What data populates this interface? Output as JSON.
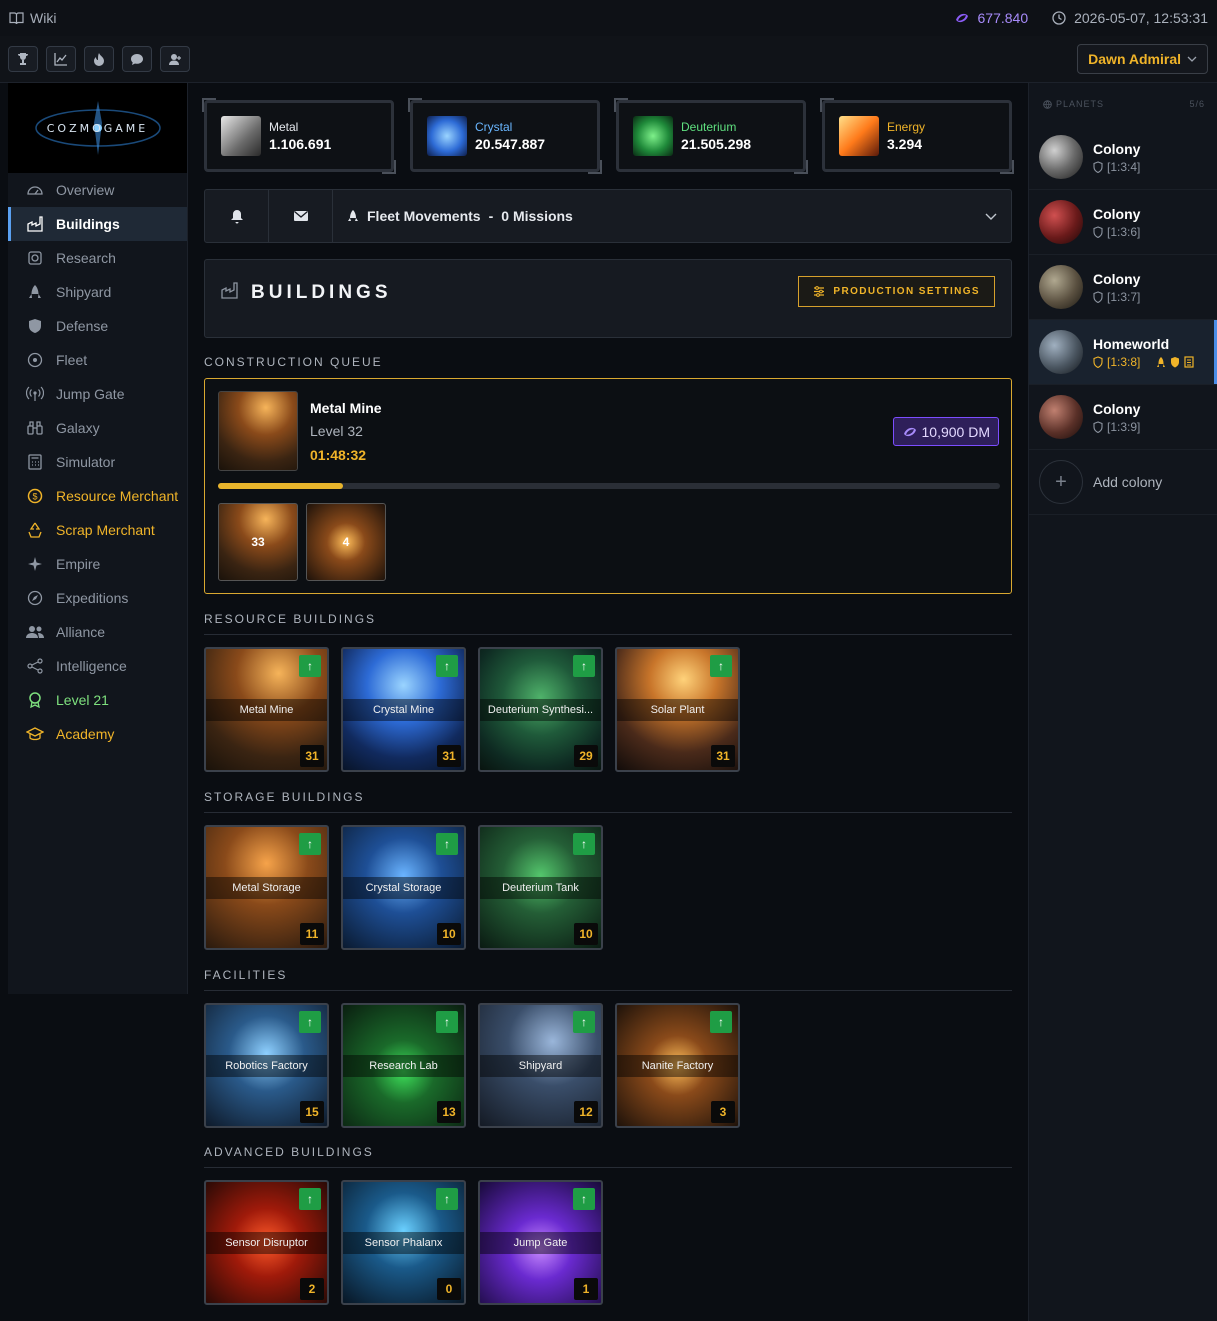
{
  "topbar": {
    "wiki": "Wiki",
    "dm": "677.840",
    "datetime": "2026-05-07, 12:53:31"
  },
  "toolbar": {
    "user": "Dawn Admiral"
  },
  "logo": "COZMOGAME",
  "nav": [
    {
      "label": "Overview",
      "icon": "dashboard-icon"
    },
    {
      "label": "Buildings",
      "icon": "factory-icon"
    },
    {
      "label": "Research",
      "icon": "research-icon"
    },
    {
      "label": "Shipyard",
      "icon": "rocket-icon"
    },
    {
      "label": "Defense",
      "icon": "shield-icon"
    },
    {
      "label": "Fleet",
      "icon": "fleet-icon"
    },
    {
      "label": "Jump Gate",
      "icon": "antenna-icon"
    },
    {
      "label": "Galaxy",
      "icon": "binoculars-icon"
    },
    {
      "label": "Simulator",
      "icon": "calculator-icon"
    },
    {
      "label": "Resource Merchant",
      "icon": "coin-icon"
    },
    {
      "label": "Scrap Merchant",
      "icon": "recycle-icon"
    },
    {
      "label": "Empire",
      "icon": "sparkle-icon"
    },
    {
      "label": "Expeditions",
      "icon": "compass-icon"
    },
    {
      "label": "Alliance",
      "icon": "users-icon"
    },
    {
      "label": "Intelligence",
      "icon": "share-icon"
    },
    {
      "label": "Level 21",
      "icon": "award-icon"
    },
    {
      "label": "Academy",
      "icon": "graduation-icon"
    }
  ],
  "resources": [
    {
      "name": "Metal",
      "value": "1.106.691",
      "color": "#e6e9ee"
    },
    {
      "name": "Crystal",
      "value": "20.547.887",
      "color": "#6ab7ff"
    },
    {
      "name": "Deuterium",
      "value": "21.505.298",
      "color": "#5fe07f"
    },
    {
      "name": "Energy",
      "value": "3.294",
      "color": "#f0b429"
    }
  ],
  "fleet": {
    "label": "Fleet Movements",
    "count": "0 Missions"
  },
  "page": {
    "title": "BUILDINGS",
    "production_btn": "PRODUCTION SETTINGS"
  },
  "sections": {
    "queue": "CONSTRUCTION QUEUE",
    "resource": "RESOURCE BUILDINGS",
    "storage": "STORAGE BUILDINGS",
    "facilities": "FACILITIES",
    "advanced": "ADVANCED BUILDINGS"
  },
  "queue": {
    "name": "Metal Mine",
    "level": "Level 32",
    "time": "01:48:32",
    "dm_cost": "10,900 DM",
    "progress": 0.16,
    "next": [
      "33",
      "4"
    ]
  },
  "buildings": {
    "resource": [
      {
        "name": "Metal Mine",
        "level": "31"
      },
      {
        "name": "Crystal Mine",
        "level": "31"
      },
      {
        "name": "Deuterium Synthesi...",
        "level": "29"
      },
      {
        "name": "Solar Plant",
        "level": "31"
      }
    ],
    "storage": [
      {
        "name": "Metal Storage",
        "level": "11"
      },
      {
        "name": "Crystal Storage",
        "level": "10"
      },
      {
        "name": "Deuterium Tank",
        "level": "10"
      }
    ],
    "facilities": [
      {
        "name": "Robotics Factory",
        "level": "15"
      },
      {
        "name": "Research Lab",
        "level": "13"
      },
      {
        "name": "Shipyard",
        "level": "12"
      },
      {
        "name": "Nanite Factory",
        "level": "3"
      }
    ],
    "advanced": [
      {
        "name": "Sensor Disruptor",
        "level": "2"
      },
      {
        "name": "Sensor Phalanx",
        "level": "0"
      },
      {
        "name": "Jump Gate",
        "level": "1"
      }
    ]
  },
  "planets": {
    "header": "PLANETS",
    "count": "5/6",
    "list": [
      {
        "name": "Colony",
        "coords": "[1:3:4]"
      },
      {
        "name": "Colony",
        "coords": "[1:3:6]"
      },
      {
        "name": "Colony",
        "coords": "[1:3:7]"
      },
      {
        "name": "Homeworld",
        "coords": "[1:3:8]"
      },
      {
        "name": "Colony",
        "coords": "[1:3:9]"
      }
    ],
    "add": "Add colony"
  }
}
